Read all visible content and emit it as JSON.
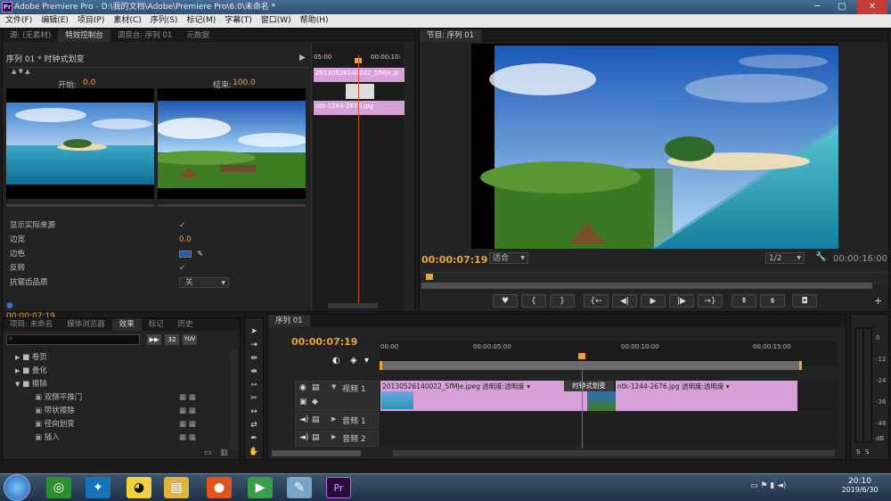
{
  "window": {
    "title": "Adobe Premiere Pro - D:\\我的文档\\Adobe\\Premiere Pro\\6.0\\未命名 *",
    "app_icon_label": "Pr"
  },
  "menu": [
    "文件(F)",
    "编辑(E)",
    "项目(P)",
    "素材(C)",
    "序列(S)",
    "标记(M)",
    "字幕(T)",
    "窗口(W)",
    "帮助(H)"
  ],
  "source_panel": {
    "tabs": [
      "源: (无素材)",
      "特效控制台",
      "调音台: 序列 01",
      "元数据"
    ],
    "active_tab": 1,
    "sequence_label": "序列 01 * 时钟式划变",
    "start_label": "开始:",
    "start_value": "0.0",
    "end_label": "结束:",
    "end_value": "100.0",
    "mini_timeline": {
      "time_a": "05:00",
      "time_b": "00:00:10:",
      "clip_a": "20130526140022_5fMJe.jp",
      "clip_b": "ntk-1244-2676.jpg"
    },
    "properties": [
      {
        "label": "显示实际来源",
        "value": "✓"
      },
      {
        "label": "边宽",
        "value": "0.0"
      },
      {
        "label": "边色",
        "value": ""
      },
      {
        "label": "反转",
        "value": "✓"
      },
      {
        "label": "抗锯齿品质",
        "value": "关"
      }
    ],
    "timecode": "00:00:07:19"
  },
  "program_panel": {
    "tab": "节目: 序列 01",
    "timecode": "00:00:07:19",
    "fit": "适合",
    "resolution": "1/2",
    "duration": "00:00:16:00"
  },
  "project_panel": {
    "tabs": [
      "项目: 未命名",
      "媒体浏览器",
      "效果",
      "标记",
      "历史"
    ],
    "active_tab": 2,
    "badges": [
      "32",
      "YUV"
    ],
    "tree": [
      {
        "label": "卷页",
        "level": 0,
        "type": "folder"
      },
      {
        "label": "叠化",
        "level": 0,
        "type": "folder"
      },
      {
        "label": "擦除",
        "level": 0,
        "type": "folder",
        "open": true
      },
      {
        "label": "双侧平推门",
        "level": 1,
        "type": "effect"
      },
      {
        "label": "带状擦除",
        "level": 1,
        "type": "effect"
      },
      {
        "label": "径向划变",
        "level": 1,
        "type": "effect"
      },
      {
        "label": "插入",
        "level": 1,
        "type": "effect"
      }
    ]
  },
  "timeline": {
    "tab": "序列 01",
    "timecode": "00:00:07:19",
    "ruler": [
      "00:00",
      "00:00:05:00",
      "00:00:10:00",
      "00:00:15:00"
    ],
    "tracks": [
      {
        "name": "视频 1",
        "type": "video"
      },
      {
        "name": "音频 1",
        "type": "audio"
      },
      {
        "name": "音频 2",
        "type": "audio"
      }
    ],
    "clip_a": "20130526140022_5fMJe.jpeg",
    "clip_a_fx": "透明度:透明度",
    "transition": "时钟式划变",
    "clip_b": "ntk-1244-2676.jpg",
    "clip_b_fx": "透明度:透明度"
  },
  "audio_meter": {
    "labels": [
      "0",
      "-12",
      "-24",
      "-36",
      "-48",
      "dB"
    ],
    "solo": [
      "S",
      "S"
    ]
  },
  "taskbar": {
    "time": "20:10",
    "date": "2019/6/30"
  },
  "colors": {
    "accent": "#e8a33a",
    "clip_pink": "#d7a0d8",
    "playhead": "#d0523a",
    "title_blue": "#3d5f87"
  }
}
